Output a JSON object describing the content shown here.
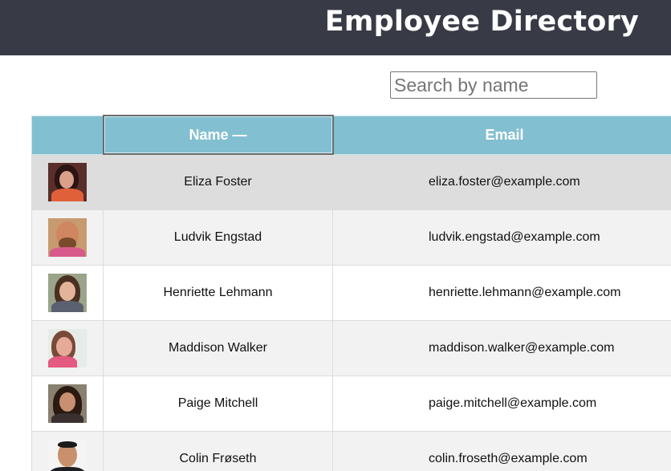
{
  "header": {
    "title": "Employee Directory"
  },
  "search": {
    "placeholder": "Search by name",
    "value": ""
  },
  "table": {
    "columns": [
      {
        "label": ""
      },
      {
        "label": "Name —"
      },
      {
        "label": "Email"
      }
    ],
    "rows": [
      {
        "name": "Eliza Foster",
        "email": "eliza.foster@example.com",
        "avatar": "eliza-foster-photo"
      },
      {
        "name": "Ludvik Engstad",
        "email": "ludvik.engstad@example.com",
        "avatar": "ludvik-engstad-photo"
      },
      {
        "name": "Henriette Lehmann",
        "email": "henriette.lehmann@example.com",
        "avatar": "henriette-lehmann-photo"
      },
      {
        "name": "Maddison Walker",
        "email": "maddison.walker@example.com",
        "avatar": "maddison-walker-photo"
      },
      {
        "name": "Paige Mitchell",
        "email": "paige.mitchell@example.com",
        "avatar": "paige-mitchell-photo"
      },
      {
        "name": "Colin Frøseth",
        "email": "colin.froseth@example.com",
        "avatar": "colin-froseth-photo"
      }
    ]
  },
  "colors": {
    "topbar": "#383b45",
    "header_row": "#82bfd0",
    "row_alt": "#f2f2f2",
    "row_highlight": "#dddddd"
  }
}
